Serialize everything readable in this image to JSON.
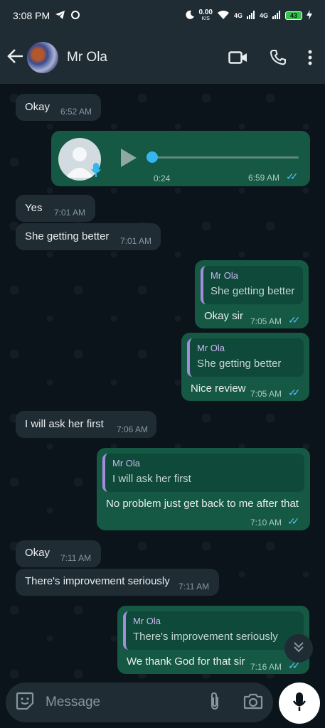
{
  "status_bar": {
    "time": "3:08 PM",
    "net_speed": "0.00",
    "net_unit": "K/S",
    "signal1": "4G",
    "signal2": "4G",
    "battery": "43"
  },
  "header": {
    "contact_name": "Mr Ola",
    "icons": [
      "back-arrow-icon",
      "video-call-icon",
      "phone-icon",
      "more-options-icon"
    ]
  },
  "messages": [
    {
      "dir": "in",
      "text": "Okay",
      "time": "6:52 AM"
    },
    {
      "dir": "out",
      "type": "voice",
      "duration": "0:24",
      "time": "6:59 AM"
    },
    {
      "dir": "in",
      "text": "Yes",
      "time": "7:01 AM"
    },
    {
      "dir": "in",
      "text": "She getting better",
      "time": "7:01 AM"
    },
    {
      "dir": "out",
      "quote_name": "Mr Ola",
      "quote_text": "She getting better",
      "text": "Okay sir",
      "time": "7:05 AM"
    },
    {
      "dir": "out",
      "quote_name": "Mr Ola",
      "quote_text": "She getting better",
      "text": "Nice review",
      "time": "7:05 AM"
    },
    {
      "dir": "in",
      "text": "I will ask her first",
      "time": "7:06 AM"
    },
    {
      "dir": "out",
      "quote_name": "Mr Ola",
      "quote_text": "I will ask her first",
      "text": "No problem just get back to me after that",
      "time": "7:10 AM"
    },
    {
      "dir": "in",
      "text": "Okay",
      "time": "7:11 AM"
    },
    {
      "dir": "in",
      "text": "There's improvement seriously",
      "time": "7:11 AM"
    },
    {
      "dir": "out",
      "quote_name": "Mr Ola",
      "quote_text": "There's improvement seriously",
      "text": "We thank God for that sir",
      "time": "7:16 AM"
    }
  ],
  "composer": {
    "placeholder": "Message"
  },
  "colors": {
    "background": "#0b141a",
    "incoming_bubble": "#1f2c34",
    "outgoing_bubble": "#155844",
    "read_ticks": "#53bdeb",
    "quote_bar": "#a58bdc"
  }
}
